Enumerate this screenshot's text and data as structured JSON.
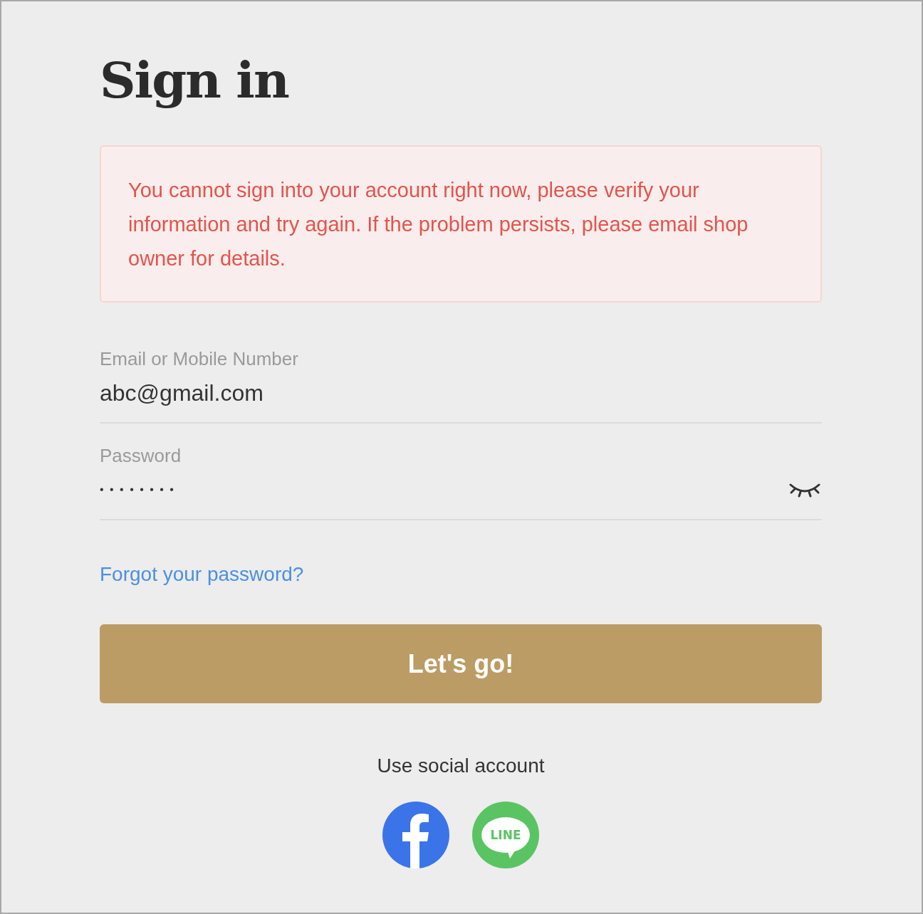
{
  "title": "Sign in",
  "error_message": "You cannot sign into your account right now, please verify your information and try again. If the problem persists, please email shop owner for details.",
  "fields": [
    {
      "kind": "text",
      "label": "Email or Mobile Number",
      "value": "abc@gmail.com"
    },
    {
      "kind": "password",
      "label": "Password",
      "value": "• • • • • • • •"
    }
  ],
  "forgot_link": "Forgot your password?",
  "submit_button": "Let's go!",
  "social": {
    "heading": "Use social account",
    "providers": [
      {
        "kind": "facebook",
        "color": "#3b74e8"
      },
      {
        "kind": "line",
        "color": "#5ac463",
        "label": "LINE"
      }
    ]
  }
}
